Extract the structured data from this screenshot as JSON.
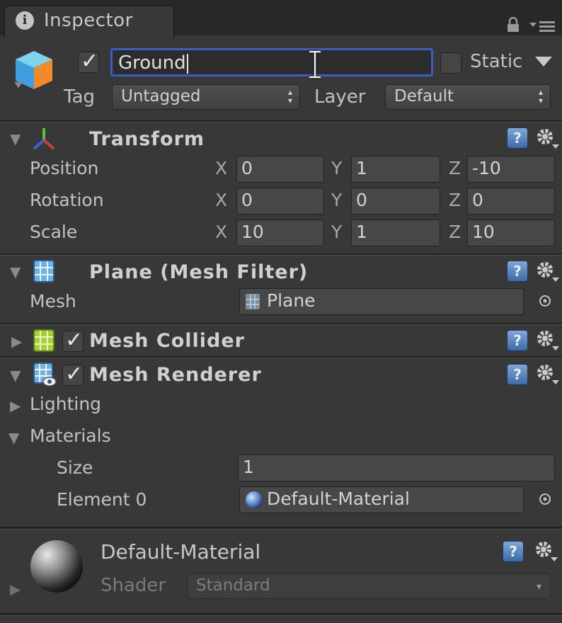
{
  "window": {
    "tab_label": "Inspector",
    "tab_icon": "info-icon"
  },
  "header": {
    "active": true,
    "name_value": "Ground",
    "static_label": "Static",
    "static_checked": false,
    "tag_label": "Tag",
    "tag_value": "Untagged",
    "layer_label": "Layer",
    "layer_value": "Default"
  },
  "transform": {
    "title": "Transform",
    "rows": [
      {
        "label": "Position",
        "x": "0",
        "y": "1",
        "z": "-10"
      },
      {
        "label": "Rotation",
        "x": "0",
        "y": "0",
        "z": "0"
      },
      {
        "label": "Scale",
        "x": "10",
        "y": "1",
        "z": "10"
      }
    ],
    "axis_labels": {
      "x": "X",
      "y": "Y",
      "z": "Z"
    }
  },
  "mesh_filter": {
    "title": "Plane (Mesh Filter)",
    "mesh_label": "Mesh",
    "mesh_value": "Plane"
  },
  "mesh_collider": {
    "title": "Mesh Collider",
    "enabled": true
  },
  "mesh_renderer": {
    "title": "Mesh Renderer",
    "enabled": true,
    "lighting_label": "Lighting",
    "materials_label": "Materials",
    "size_label": "Size",
    "size_value": "1",
    "element_label": "Element 0",
    "element_value": "Default-Material"
  },
  "material": {
    "name": "Default-Material",
    "shader_label": "Shader",
    "shader_value": "Standard"
  },
  "colors": {
    "background": "#383838",
    "focus_border": "#3d5cc4",
    "help_blue": "#4f7fbf"
  }
}
